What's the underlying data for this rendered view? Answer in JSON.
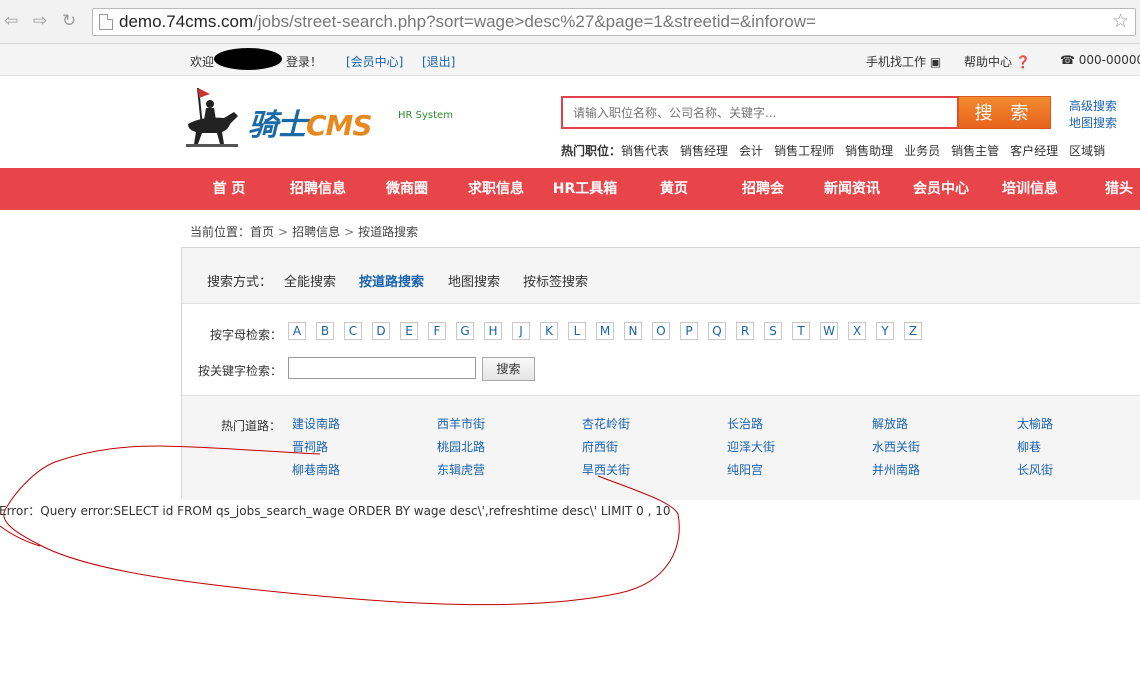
{
  "browser": {
    "url_host": "demo.74cms.com",
    "url_path": "/jobs/street-search.php?sort=wage>desc%27&page=1&streetid=&inforow="
  },
  "topbar": {
    "welcome": "欢迎",
    "login_suffix": "登录！",
    "member_center": "[会员中心]",
    "logout": "[退出]",
    "mobile": "手机找工作",
    "help": "帮助中心",
    "phone": "☎ 000-00000"
  },
  "header": {
    "logo_main": "骑士",
    "logo_cms": "CMS",
    "logo_sub": "HR System",
    "search_placeholder": "请输入职位名称、公司名称、关键字...",
    "search_button": "搜 索",
    "advanced_search": "高级搜索",
    "map_search": "地图搜索",
    "hot_jobs_label": "热门职位：",
    "hot_jobs": [
      "销售代表",
      "销售经理",
      "会计",
      "销售工程师",
      "销售助理",
      "业务员",
      "销售主管",
      "客户经理",
      "区域销"
    ]
  },
  "nav": [
    "首 页",
    "招聘信息",
    "微商圈",
    "求职信息",
    "HR工具箱",
    "黄页",
    "招聘会",
    "新闻资讯",
    "会员中心",
    "培训信息",
    "猎头"
  ],
  "breadcrumb": {
    "label": "当前位置：",
    "items": [
      "首页",
      "招聘信息",
      "按道路搜索"
    ]
  },
  "panel": {
    "mode_label": "搜索方式：",
    "tabs": [
      "全能搜索",
      "按道路搜索",
      "地图搜索",
      "按标签搜索"
    ],
    "active_tab": "按道路搜索",
    "letter_label": "按字母检索：",
    "letters": [
      "A",
      "B",
      "C",
      "D",
      "E",
      "F",
      "G",
      "H",
      "J",
      "K",
      "L",
      "M",
      "N",
      "O",
      "P",
      "Q",
      "R",
      "S",
      "T",
      "W",
      "X",
      "Y",
      "Z"
    ],
    "keyword_label": "按关键字检索：",
    "keyword_button": "搜索",
    "hot_roads_label": "热门道路：",
    "hot_roads": [
      [
        "建设南路",
        "西羊市街",
        "杏花岭街",
        "长治路",
        "解放路",
        "太榆路"
      ],
      [
        "晋祠路",
        "桃园北路",
        "府西街",
        "迎泽大街",
        "水西关街",
        "柳巷"
      ],
      [
        "柳巷南路",
        "东辑虎营",
        "旱西关街",
        "纯阳宫",
        "并州南路",
        "长风街"
      ]
    ]
  },
  "error": "Error：Query error:SELECT id FROM qs_jobs_search_wage ORDER BY wage desc\\',refreshtime desc\\' LIMIT 0 , 10",
  "colors": {
    "nav_red": "#e8454a",
    "link_blue": "#1b63ad",
    "search_orange": "#e7631c",
    "annotation_red": "#c00000"
  }
}
